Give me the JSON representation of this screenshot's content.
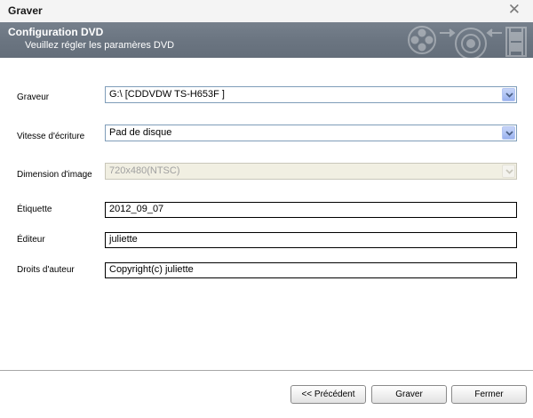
{
  "window": {
    "title": "Graver",
    "close_glyph": "✕"
  },
  "header": {
    "title": "Configuration DVD",
    "subtitle": "Veuillez régler les paramères DVD",
    "art_icons": [
      "film-reel-icon",
      "arrow-right-icon",
      "dvd-disc-icon",
      "arrow-left-icon",
      "film-strip-icon"
    ]
  },
  "form": {
    "graveur": {
      "label": "Graveur",
      "value": "G:\\ [CDDVDW TS-H653F ]"
    },
    "vitesse": {
      "label": "Vitesse d'écriture",
      "value": "Pad de disque"
    },
    "dimension": {
      "label": "Dimension d'image",
      "value": "720x480(NTSC)",
      "disabled": true
    },
    "etiquette": {
      "label": "Étiquette",
      "value": "2012_09_07"
    },
    "editeur": {
      "label": "Éditeur",
      "value": "juliette"
    },
    "droits": {
      "label": "Droits d'auteur",
      "value": "Copyright(c) juliette"
    }
  },
  "buttons": {
    "previous": "<< Précédent",
    "burn": "Graver",
    "close": "Fermer"
  },
  "colors": {
    "header_bg": "#6b7581",
    "combo_border": "#7f9db9",
    "combo_button": "#b1c5f5"
  }
}
